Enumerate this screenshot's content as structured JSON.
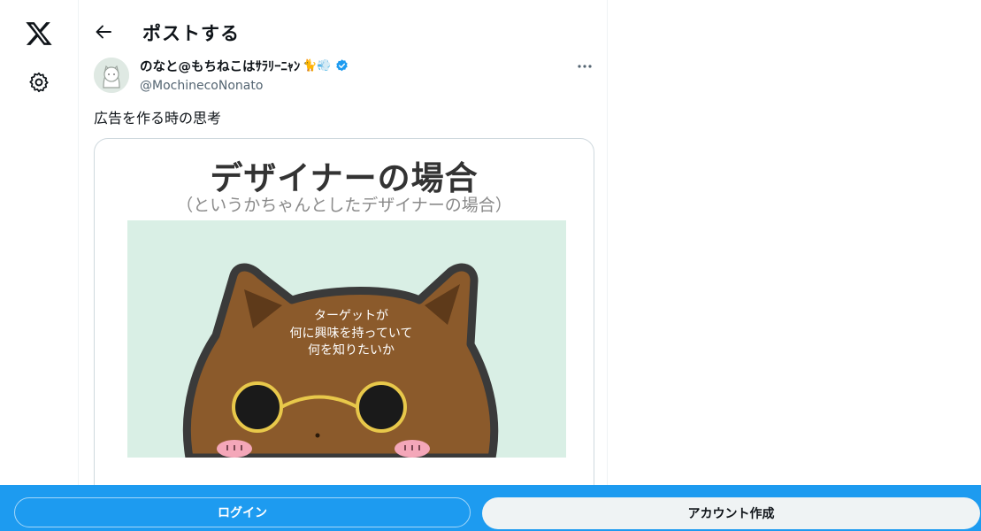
{
  "nav": {
    "logo_icon": "x-logo-icon",
    "settings_icon": "gear-icon"
  },
  "header": {
    "title": "ポストする",
    "back_icon": "back-arrow-icon"
  },
  "post": {
    "author_name": "のなと@もちねこはｻﾗﾘｰﾆｬﾝ",
    "author_emoji": "🐈💨",
    "handle": "@MochinecoNonato",
    "text": "広告を作る時の思考",
    "verified": true
  },
  "card": {
    "heading": "デザイナーの場合",
    "subheading": "（というかちゃんとしたデザイナーの場合）",
    "speech_lines": [
      "ターゲットが",
      "何に興味を持っていて",
      "何を知りたいか"
    ]
  },
  "bottom": {
    "login": "ログイン",
    "signup": "アカウント作成"
  },
  "colors": {
    "accent": "#1d9bf0",
    "bg_mint": "#d9efe5",
    "cat_brown": "#8b5a2b"
  }
}
